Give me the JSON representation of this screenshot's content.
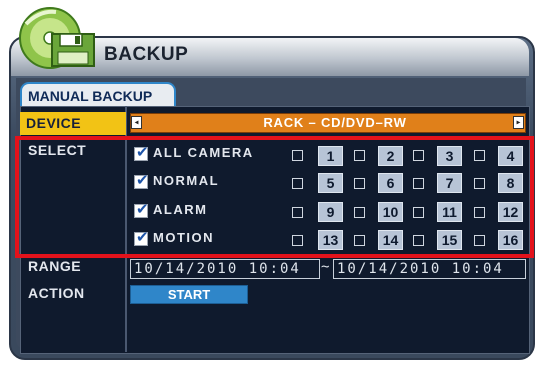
{
  "window": {
    "title": "BACKUP",
    "icon": "backup-disc-icon"
  },
  "tab": {
    "label": "MANUAL BACKUP"
  },
  "device": {
    "label": "DEVICE",
    "value": "RACK – CD/DVD–RW",
    "left_arrow": "◂",
    "right_arrow": "▸"
  },
  "select": {
    "label": "SELECT",
    "rows": [
      {
        "label": "ALL CAMERA",
        "checked": true,
        "channels": [
          "1",
          "2",
          "3",
          "4"
        ]
      },
      {
        "label": "NORMAL",
        "checked": true,
        "channels": [
          "5",
          "6",
          "7",
          "8"
        ]
      },
      {
        "label": "ALARM",
        "checked": true,
        "channels": [
          "9",
          "10",
          "11",
          "12"
        ]
      },
      {
        "label": "MOTION",
        "checked": true,
        "channels": [
          "13",
          "14",
          "15",
          "16"
        ]
      }
    ]
  },
  "range": {
    "label": "RANGE",
    "from": "10/14/2010  10:04",
    "separator": "~",
    "to": "10/14/2010  10:04"
  },
  "action": {
    "label": "ACTION",
    "start_label": "START"
  },
  "colors": {
    "highlight": "#e3121b",
    "device_bar": "#e0801a",
    "label_active": "#f2c315",
    "button": "#2f86c9"
  }
}
